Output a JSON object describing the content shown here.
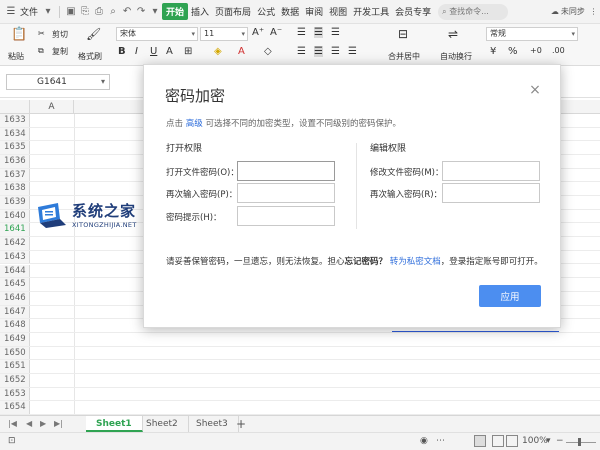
{
  "menubar": {
    "file_menu": "文件",
    "items": [
      "开始",
      "插入",
      "页面布局",
      "公式",
      "数据",
      "审阅",
      "视图",
      "开发工具",
      "会员专享"
    ],
    "active_item": "开始",
    "search_placeholder": "查找命令...",
    "sync_status": "未同步"
  },
  "ribbon": {
    "paste": "粘贴",
    "cut": "剪切",
    "copy": "复制",
    "format_painter": "格式刷",
    "font_name": "宋体",
    "font_size": "11",
    "merge_center": "合并居中",
    "wrap_text": "自动换行",
    "number_format": "常规"
  },
  "formula_bar": {
    "name_box": "G1641"
  },
  "grid": {
    "column_header": "A",
    "row_numbers": [
      "1633",
      "1634",
      "1635",
      "1636",
      "1637",
      "1638",
      "1639",
      "1640",
      "1641",
      "1642",
      "1643",
      "1644",
      "1645",
      "1646",
      "1647",
      "1648",
      "1649",
      "1650",
      "1651",
      "1652",
      "1653",
      "1654"
    ],
    "selected_row": "1641"
  },
  "watermark": {
    "title": "系统之家",
    "subtitle": "XITONGZHIJIA.NET"
  },
  "sheets": {
    "tabs": [
      "Sheet1",
      "Sheet2",
      "Sheet3"
    ],
    "active": "Sheet1",
    "add": "+"
  },
  "statusbar": {
    "zoom": "100%",
    "zoom_minus": "−"
  },
  "dialog": {
    "title": "密码加密",
    "close": "×",
    "info_prefix": "点击",
    "info_link": "高级",
    "info_suffix": "可选择不同的加密类型，设置不同级别的密码保护。",
    "open_section": "打开权限",
    "open_password_label": "打开文件密码(O)：",
    "open_confirm_label": "再次输入密码(P)：",
    "hint_label": "密码提示(H)：",
    "edit_section": "编辑权限",
    "edit_password_label": "修改文件密码(M)：",
    "edit_confirm_label": "再次输入密码(R)：",
    "note_prefix": "请妥善保管密码，一旦遗忘，则无法恢复。担心",
    "note_bold": "忘记密码？",
    "note_link": "转为私密文档",
    "note_suffix": "，登录指定账号即可打开。",
    "apply": "应用"
  },
  "colors": {
    "accent_green": "#2fa352",
    "button_blue": "#4c8ef0",
    "link_blue": "#2e6ddb"
  }
}
